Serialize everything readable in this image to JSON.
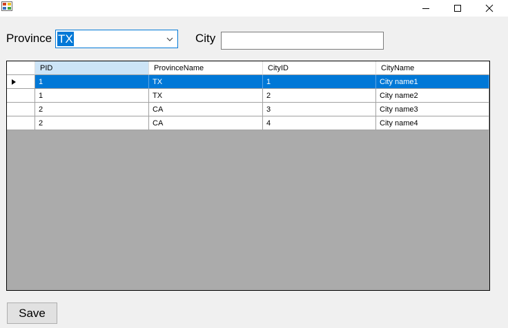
{
  "form": {
    "province_label": "Province",
    "province_value": "TX",
    "city_label": "City",
    "city_value": "",
    "save_label": "Save"
  },
  "grid": {
    "columns": [
      "PID",
      "ProvinceName",
      "CityID",
      "CityName"
    ],
    "rows": [
      [
        "1",
        "TX",
        "1",
        "City name1"
      ],
      [
        "1",
        "TX",
        "2",
        "City name2"
      ],
      [
        "2",
        "CA",
        "3",
        "City name3"
      ],
      [
        "2",
        "CA",
        "4",
        "City name4"
      ]
    ],
    "selected_row": 0,
    "selected_header": 0
  },
  "colors": {
    "selection": "#0078d7",
    "grid_background": "#ababab",
    "header_selected": "#cce4f7",
    "window_background": "#f0f0f0"
  },
  "icons": {
    "app": "app-icon",
    "minimize": "minimize-icon",
    "maximize": "maximize-icon",
    "close": "close-icon",
    "dropdown": "chevron-down-icon",
    "row_indicator": "row-indicator-icon"
  }
}
